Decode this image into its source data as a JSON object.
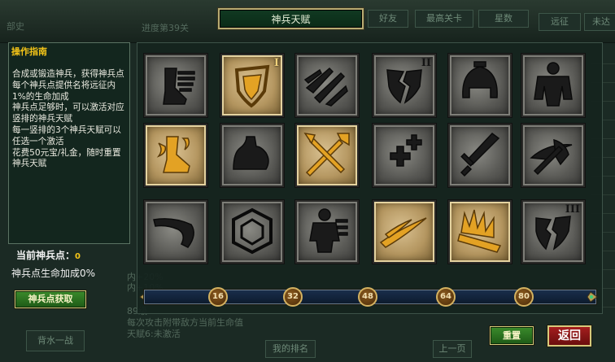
{
  "title": "神兵天赋",
  "background": {
    "top_left": "部史",
    "progress_label": "进度",
    "progress_value": "第39关",
    "tabs": [
      "好友",
      "最高关卡",
      "星数",
      "远征",
      "未达"
    ],
    "lower_text": [
      "内+20%",
      "内+10%",
      "89级",
      "每次攻击附带敌方当前生命值",
      "天赋6:未激活"
    ],
    "side_btn": "背水一战",
    "my_rank": "我的排名",
    "prev_page": "上一页"
  },
  "guide": {
    "title": "操作指南",
    "lines": [
      "合成或锻造神兵，获得神兵点",
      "每个神兵点提供名将远征内1%的生命加成",
      "神兵点足够时，可以激活对应竖排的神兵天赋",
      "每一竖排的3个神兵天赋可以任选一个激活",
      "花费50元宝/礼金，随时重置神兵天赋"
    ]
  },
  "points": {
    "label": "当前神兵点：",
    "value": "0"
  },
  "bonus": "神兵点生命加成0%",
  "buttons": {
    "get_points": "神兵点获取",
    "reset": "重置",
    "back": "返回"
  },
  "talents": [
    {
      "icon": "boot-icon",
      "active": false,
      "tier": ""
    },
    {
      "icon": "shield-icon",
      "active": true,
      "tier": "I"
    },
    {
      "icon": "claw-slash-icon",
      "active": false,
      "tier": ""
    },
    {
      "icon": "broken-shield-icon",
      "active": false,
      "tier": "II"
    },
    {
      "icon": "helmet-icon",
      "active": false,
      "tier": ""
    },
    {
      "icon": "armored-body-icon",
      "active": false,
      "tier": ""
    },
    {
      "icon": "flaming-boot-icon",
      "active": true,
      "tier": ""
    },
    {
      "icon": "flexed-arm-icon",
      "active": false,
      "tier": ""
    },
    {
      "icon": "crossed-spears-icon",
      "active": true,
      "tier": ""
    },
    {
      "icon": "health-cross-icon",
      "active": false,
      "tier": ""
    },
    {
      "icon": "sword-icon",
      "active": false,
      "tier": ""
    },
    {
      "icon": "axe-swoosh-icon",
      "active": false,
      "tier": ""
    },
    {
      "icon": "horn-icon",
      "active": false,
      "tier": ""
    },
    {
      "icon": "gem-icon",
      "active": false,
      "tier": ""
    },
    {
      "icon": "warrior-silhouette-icon",
      "active": false,
      "tier": ""
    },
    {
      "icon": "swoosh-icon",
      "active": true,
      "tier": ""
    },
    {
      "icon": "flaming-crown-icon",
      "active": true,
      "tier": ""
    },
    {
      "icon": "shattered-shield-icon",
      "active": false,
      "tier": "III"
    }
  ],
  "thresholds": [
    "16",
    "32",
    "48",
    "64",
    "80"
  ],
  "progress_fraction": 0,
  "colors": {
    "gold": "#e3a224",
    "dark_icon": "#1a1a1a",
    "title_border": "#b8ac72"
  }
}
